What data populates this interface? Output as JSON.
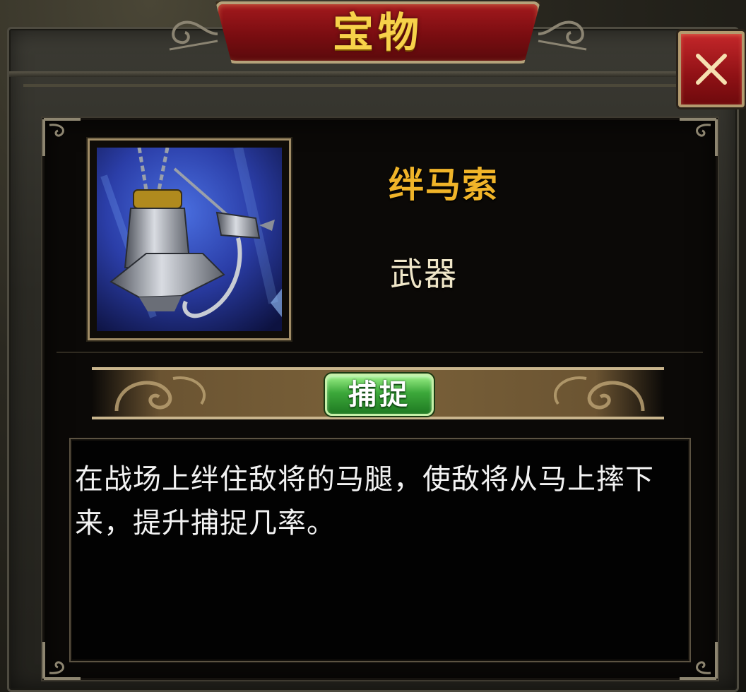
{
  "dialog": {
    "title": "宝物",
    "close_label": "×"
  },
  "item": {
    "name": "绊马索",
    "type": "武器",
    "icon": "rope-hook-weapon-icon",
    "category_tag": "捕捉",
    "description": "在战场上绊住敌将的马腿，使敌将从马上摔下来，提升捕捉几率。"
  },
  "colors": {
    "title_plaque": "#8b1216",
    "title_text": "#f7d24a",
    "item_name": "#f0b429",
    "item_type": "#efe6c8",
    "tag_button": "#3ca83a",
    "close_button": "#a5181c",
    "panel_bg": "#0b0907"
  }
}
